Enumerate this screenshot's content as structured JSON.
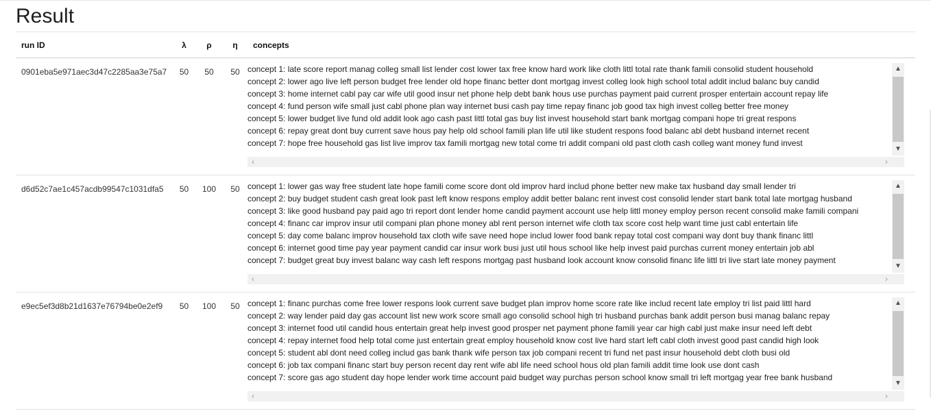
{
  "page": {
    "title": "Result"
  },
  "table": {
    "headers": {
      "run_id": "run ID",
      "lambda": "λ",
      "rho": "ρ",
      "eta": "η",
      "concepts": "concepts"
    },
    "rows": [
      {
        "run_id": "0901eba5e971aec3d47c2285aa3e75a7",
        "lambda": "50",
        "rho": "50",
        "eta": "50",
        "concepts": [
          "concept 1: late score report manag colleg small list lender cost lower tax free know hard work like cloth littl total rate thank famili consolid student household",
          "concept 2: lower ago live left person budget free lender old hope financ better dont mortgag invest colleg look high school total addit includ balanc buy candid",
          "concept 3: home internet cabl pay car wife util good insur net phone help debt bank hous use purchas payment paid current prosper entertain account repay life",
          "concept 4: fund person wife small just cabl phone plan way internet busi cash pay time repay financ job good tax high invest colleg better free money",
          "concept 5: lower budget live fund old addit look ago cash past littl total gas buy list invest household start bank mortgag compani hope tri great respons",
          "concept 6: repay great dont buy current save hous pay help old school famili plan life util like student respons food balanc abl debt husband internet recent",
          "concept 7: hope free household gas list live improv tax famili mortgag new total come tri addit compani old past cloth cash colleg want money fund invest"
        ]
      },
      {
        "run_id": "d6d52c7ae1c457acdb99547c1031dfa5",
        "lambda": "50",
        "rho": "100",
        "eta": "50",
        "concepts": [
          "concept 1: lower gas way free student late hope famili come score dont old improv hard includ phone better new make tax husband day small lender tri",
          "concept 2: buy budget student cash great look past left know respons employ addit better balanc rent invest cost consolid lender start bank total late mortgag husband",
          "concept 3: like good husband pay paid ago tri report dont lender home candid payment account use help littl money employ person recent consolid make famili compani",
          "concept 4: financ car improv insur util compani plan phone money abl rent person internet wife cloth tax score cost help want time just cabl entertain life",
          "concept 5: day come balanc improv household tax cloth wife save need hope includ lower food bank repay total cost compani way dont buy thank financ littl",
          "concept 6: internet good time pay year payment candid car insur work busi just util hous school like help invest paid purchas current money entertain job abl",
          "concept 7: budget great buy invest balanc way cash left respons mortgag past husband look account know consolid financ life littl tri live start late money payment"
        ]
      },
      {
        "run_id": "e9ec5ef3d8b21d1637e76794be0e2ef9",
        "lambda": "50",
        "rho": "100",
        "eta": "50",
        "concepts": [
          "concept 1: financ purchas come free lower respons look current save budget plan improv home score rate like includ recent late employ tri list paid littl hard",
          "concept 2: way lender paid day gas account list new work score small ago consolid school high tri husband purchas bank addit person busi manag balanc repay",
          "concept 3: internet food util candid hous entertain great help invest good prosper net payment phone famili year car high cabl just make insur need left debt",
          "concept 4: repay internet food help total come just entertain great employ household know cost live hard start left cabl cloth invest good past candid high look",
          "concept 5: student abl dont need colleg includ gas bank thank wife person tax job compani recent tri fund net past insur household debt cloth busi old",
          "concept 6: job tax compani financ start buy person recent day rent wife abl life need school hous old plan famili addit time look use dont cash",
          "concept 7: score gas ago student day hope lender work time account paid budget way purchas person school know small tri left mortgag year free bank husband"
        ]
      }
    ]
  },
  "icons": {
    "scroll_up": "chevron-up-icon",
    "scroll_down": "chevron-down-icon",
    "scroll_left": "chevron-left-icon",
    "scroll_right": "chevron-right-icon"
  }
}
